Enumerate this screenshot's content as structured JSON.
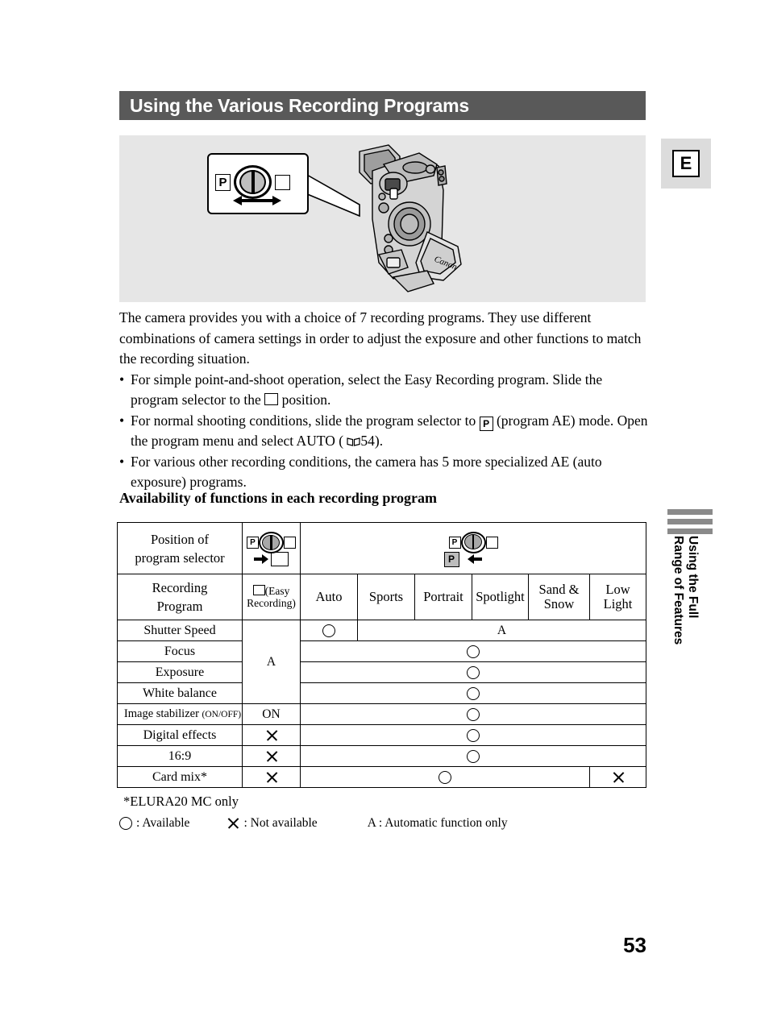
{
  "header": {
    "title": "Using the Various Recording Programs"
  },
  "illustration": {
    "callout": {
      "p_label": "P",
      "square_label": "",
      "arrow": "double-arrow"
    },
    "camera_brand": "Canon"
  },
  "body": {
    "intro": "The camera provides you with a choice of 7 recording programs. They use different combinations of camera settings in order to adjust the exposure and other functions to match the recording situation.",
    "bullet_marker": "•",
    "bullets": [
      {
        "part1": "For simple point-and-shoot operation, select the Easy Recording program. Slide the program selector to the ",
        "glyph": "square-icon",
        "part2": " position."
      },
      {
        "part1": "For normal shooting conditions, slide the program selector to ",
        "glyph": "p-icon",
        "part2": " (program AE) mode. Open the program menu and select AUTO ( ",
        "glyph2": "book-icon",
        "part3": "54)."
      },
      {
        "part1": "For various other recording conditions, the camera has 5 more specialized AE (auto exposure) programs.",
        "part2": "",
        "part3": ""
      }
    ]
  },
  "section": {
    "heading": "Availability of functions in each recording program"
  },
  "table": {
    "header_rows": {
      "position_label_line1": "Position of",
      "position_label_line2": "program selector",
      "recording_label_line1": "Recording",
      "recording_label_line2": "Program",
      "easy_col_line1": "(Easy",
      "easy_col_line2": "Recording)"
    },
    "columns": [
      "Auto",
      "Sports",
      "Portrait",
      "Spotlight",
      "Sand &\nSnow",
      "Low\nLight"
    ],
    "col_auto": "Auto",
    "col_sports": "Sports",
    "col_portrait": "Portrait",
    "col_spotlight": "Spotlight",
    "col_sand_l1": "Sand &",
    "col_sand_l2": "Snow",
    "col_low_l1": "Low",
    "col_low_l2": "Light",
    "rows": [
      {
        "label": "Shutter Speed",
        "easy": "A",
        "auto": "circle",
        "rest": "A"
      },
      {
        "label": "Focus",
        "easy": "A",
        "rest": "circle"
      },
      {
        "label": "Exposure",
        "easy": "A",
        "rest": "circle"
      },
      {
        "label": "White balance",
        "easy": "A",
        "rest": "circle"
      },
      {
        "label": "Image stabilizer ",
        "label_small": "(ON/OFF)",
        "easy": "ON",
        "rest": "circle"
      },
      {
        "label": "Digital effects",
        "easy": "cross",
        "rest": "circle"
      },
      {
        "label": "16:9",
        "easy": "cross",
        "rest": "circle"
      },
      {
        "label": "Card mix*",
        "easy": "cross",
        "rest": "circle",
        "last": "cross"
      }
    ],
    "row_labels": {
      "shutter_speed": "Shutter Speed",
      "focus": "Focus",
      "exposure": "Exposure",
      "white_balance": "White balance",
      "image_stabilizer": "Image stabilizer ",
      "image_stabilizer_small": "(ON/OFF)",
      "digital_effects": "Digital effects",
      "aspect_169": "16:9",
      "card_mix": "Card mix*"
    },
    "values": {
      "easy_a": "A",
      "easy_on": "ON",
      "shutter_rest": "A"
    }
  },
  "footnote": {
    "text": "*ELURA20 MC only"
  },
  "legend": {
    "available": ": Available",
    "not_available": ": Not available",
    "automatic": "A : Automatic function only"
  },
  "sidebar": {
    "tab_letter": "E",
    "vertical_line1": "Using the Full",
    "vertical_line2": "Range of Features"
  },
  "footer": {
    "page_number": "53"
  }
}
